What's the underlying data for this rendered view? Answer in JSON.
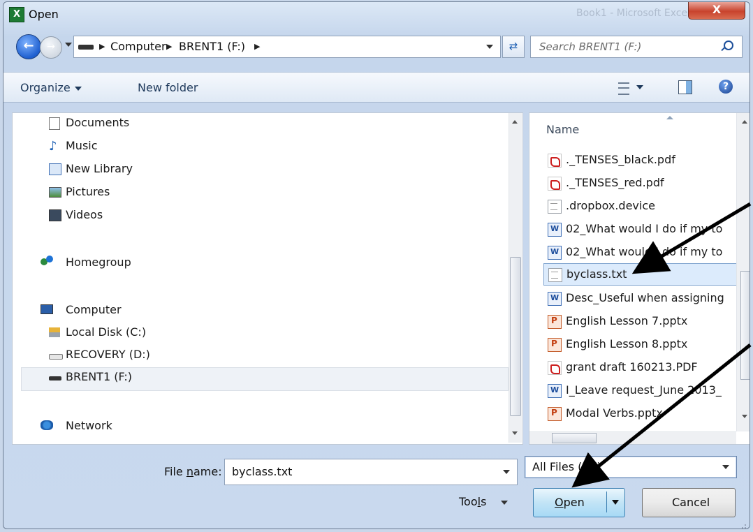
{
  "window": {
    "title": "Open",
    "app_icon_letter": "X",
    "ghost_title": "Book1 - Microsoft Excel",
    "close_label": "X"
  },
  "address_bar": {
    "segments": [
      "Computer",
      "BRENT1 (F:)"
    ],
    "search_placeholder": "Search BRENT1 (F:)"
  },
  "toolbar": {
    "organize": "Organize",
    "new_folder": "New folder"
  },
  "nav_pane": {
    "items": [
      {
        "label": "Documents",
        "icon": "documents-icon"
      },
      {
        "label": "Music",
        "icon": "music-icon"
      },
      {
        "label": "New Library",
        "icon": "library-icon"
      },
      {
        "label": "Pictures",
        "icon": "pictures-icon"
      },
      {
        "label": "Videos",
        "icon": "videos-icon"
      },
      {
        "label": "Homegroup",
        "icon": "homegroup-icon"
      },
      {
        "label": "Computer",
        "icon": "computer-icon"
      },
      {
        "label": "Local Disk (C:)",
        "icon": "local-disk-icon"
      },
      {
        "label": "RECOVERY (D:)",
        "icon": "drive-icon"
      },
      {
        "label": "BRENT1 (F:)",
        "icon": "drive-icon"
      },
      {
        "label": "Network",
        "icon": "network-icon"
      }
    ],
    "selected": "BRENT1 (F:)"
  },
  "file_pane": {
    "column_header": "Name",
    "files": [
      {
        "name": "._TENSES_black.pdf",
        "type": "pdf"
      },
      {
        "name": "._TENSES_red.pdf",
        "type": "pdf"
      },
      {
        "name": ".dropbox.device",
        "type": "txt"
      },
      {
        "name": "02_What would I do if my to",
        "type": "doc"
      },
      {
        "name": "02_What would I do if my to",
        "type": "doc"
      },
      {
        "name": "byclass.txt",
        "type": "txt"
      },
      {
        "name": "Desc_Useful when assigning",
        "type": "doc"
      },
      {
        "name": "English Lesson 7.pptx",
        "type": "ppt"
      },
      {
        "name": "English Lesson 8.pptx",
        "type": "ppt"
      },
      {
        "name": "grant draft 160213.PDF",
        "type": "pdf"
      },
      {
        "name": "I_Leave request_June 2013_",
        "type": "doc"
      },
      {
        "name": "Modal Verbs.pptx",
        "type": "ppt"
      }
    ],
    "selected_file": "byclass.txt"
  },
  "footer": {
    "file_name_label_pre": "File ",
    "file_name_label_u": "n",
    "file_name_label_post": "ame:",
    "file_name_value": "byclass.txt",
    "filter_value": "All Files (*.*)",
    "tools_pre": "Too",
    "tools_u": "l",
    "tools_post": "s",
    "open_u": "O",
    "open_post": "pen",
    "cancel": "Cancel"
  },
  "colors": {
    "selection": "#dcebfc",
    "arrow": "#000000",
    "title_gradient": "#c5d6ec"
  }
}
